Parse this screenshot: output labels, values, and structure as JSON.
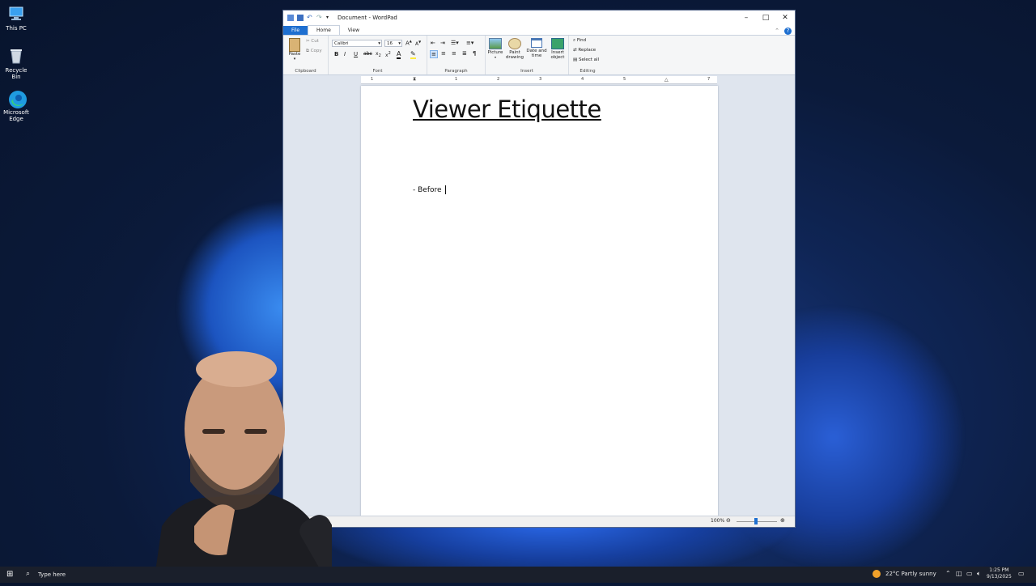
{
  "desktop": {
    "icons": [
      {
        "label": "This PC",
        "icon": "computer-icon"
      },
      {
        "label": "Recycle Bin",
        "icon": "recycle-bin-icon"
      },
      {
        "label": "Microsoft Edge",
        "icon": "edge-icon"
      }
    ]
  },
  "window": {
    "title": "Document - WordPad",
    "tabs": [
      "File",
      "Home",
      "View"
    ],
    "clipboard": {
      "paste": "Paste",
      "cut": "Cut",
      "copy": "Copy",
      "label": "Clipboard"
    },
    "font": {
      "family": "Calibri",
      "size": "16",
      "label": "Font"
    },
    "paragraph": {
      "label": "Paragraph"
    },
    "insert": {
      "picture": "Picture",
      "paint": "Paint drawing",
      "datetime": "Date and time",
      "object": "Insert object",
      "label": "Insert"
    },
    "editing": {
      "find": "Find",
      "replace": "Replace",
      "select_all": "Select all",
      "label": "Editing"
    },
    "ruler_numbers": [
      "1",
      "1",
      "2",
      "3",
      "4",
      "5",
      "6",
      "7"
    ],
    "document": {
      "title": "Viewer Etiquette",
      "line1": "- Before "
    },
    "status": {
      "zoom": "100%"
    }
  },
  "taskbar": {
    "search_placeholder": "Type here",
    "weather": "22°C  Partly sunny",
    "time": "1:25 PM",
    "date": "9/13/2025"
  },
  "colors": {
    "accent": "#1e6fd0",
    "desktop": "#0b1a3a"
  }
}
